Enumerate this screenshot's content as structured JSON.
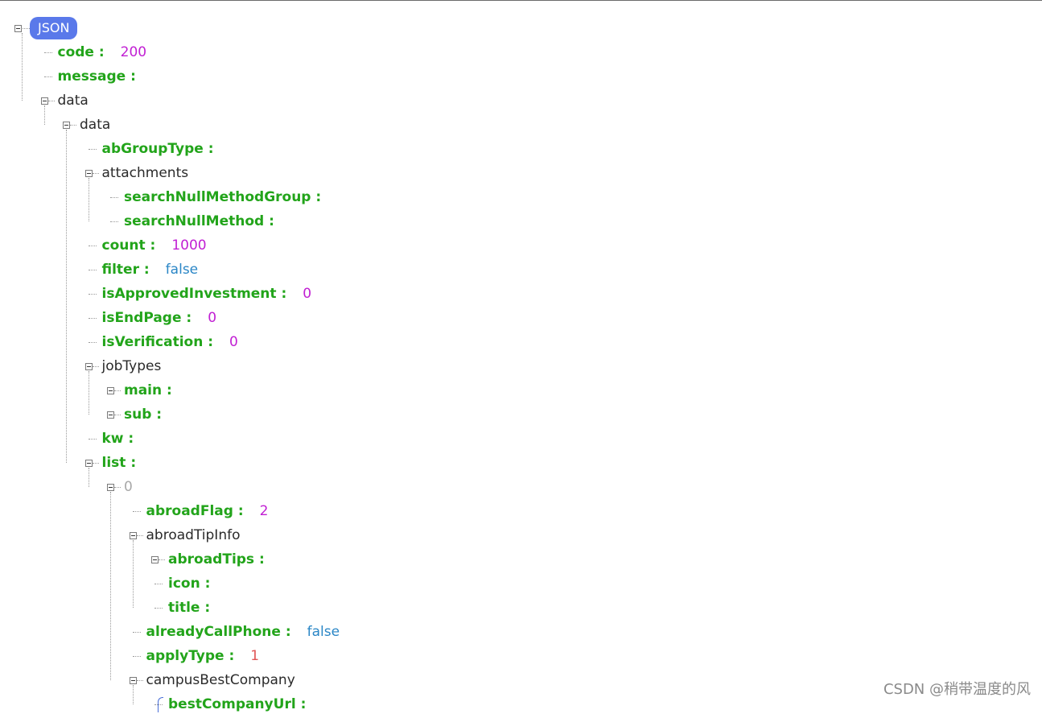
{
  "root_label": "JSON",
  "watermark": "CSDN @稍带温度的风",
  "colors": {
    "key": "#22a41a",
    "number": "#c11fd3",
    "boolean": "#2a86c6",
    "string_number": "#e05555",
    "index": "#a8a8a8",
    "root_badge": "#5a79ea"
  },
  "nodes": [
    {
      "depth": 1,
      "key": "code",
      "value": "200",
      "vtype": "num",
      "toggle": false
    },
    {
      "depth": 1,
      "key": "message",
      "value": "",
      "vtype": "",
      "toggle": false
    },
    {
      "depth": 1,
      "key": "data",
      "value": "",
      "vtype": "",
      "toggle": true,
      "plain": true
    },
    {
      "depth": 2,
      "key": "data",
      "value": "",
      "vtype": "",
      "toggle": true,
      "plain": true
    },
    {
      "depth": 3,
      "key": "abGroupType",
      "value": "",
      "vtype": "",
      "toggle": false
    },
    {
      "depth": 3,
      "key": "attachments",
      "value": "",
      "vtype": "",
      "toggle": true,
      "plain": true
    },
    {
      "depth": 4,
      "key": "searchNullMethodGroup",
      "value": "",
      "vtype": "",
      "toggle": false
    },
    {
      "depth": 4,
      "key": "searchNullMethod",
      "value": "",
      "vtype": "",
      "toggle": false
    },
    {
      "depth": 3,
      "key": "count",
      "value": "1000",
      "vtype": "num",
      "toggle": false
    },
    {
      "depth": 3,
      "key": "filter",
      "value": "false",
      "vtype": "bool",
      "toggle": false
    },
    {
      "depth": 3,
      "key": "isApprovedInvestment",
      "value": "0",
      "vtype": "num",
      "toggle": false
    },
    {
      "depth": 3,
      "key": "isEndPage",
      "value": "0",
      "vtype": "num",
      "toggle": false
    },
    {
      "depth": 3,
      "key": "isVerification",
      "value": "0",
      "vtype": "num",
      "toggle": false
    },
    {
      "depth": 3,
      "key": "jobTypes",
      "value": "",
      "vtype": "",
      "toggle": true,
      "plain": true
    },
    {
      "depth": 4,
      "key": "main",
      "value": "",
      "vtype": "",
      "toggle": true
    },
    {
      "depth": 4,
      "key": "sub",
      "value": "",
      "vtype": "",
      "toggle": true
    },
    {
      "depth": 3,
      "key": "kw",
      "value": "",
      "vtype": "",
      "toggle": false
    },
    {
      "depth": 3,
      "key": "list",
      "value": "",
      "vtype": "",
      "toggle": true
    },
    {
      "depth": 4,
      "key": "0",
      "value": "",
      "vtype": "",
      "toggle": true,
      "index": true
    },
    {
      "depth": 5,
      "key": "abroadFlag",
      "value": "2",
      "vtype": "num",
      "toggle": false
    },
    {
      "depth": 5,
      "key": "abroadTipInfo",
      "value": "",
      "vtype": "",
      "toggle": true,
      "plain": true
    },
    {
      "depth": 6,
      "key": "abroadTips",
      "value": "",
      "vtype": "",
      "toggle": true
    },
    {
      "depth": 6,
      "key": "icon",
      "value": "",
      "vtype": "",
      "toggle": false
    },
    {
      "depth": 6,
      "key": "title",
      "value": "",
      "vtype": "",
      "toggle": false
    },
    {
      "depth": 5,
      "key": "alreadyCallPhone",
      "value": "false",
      "vtype": "bool",
      "toggle": false
    },
    {
      "depth": 5,
      "key": "applyType",
      "value": "1",
      "vtype": "str",
      "toggle": false
    },
    {
      "depth": 5,
      "key": "campusBestCompany",
      "value": "",
      "vtype": "",
      "toggle": true,
      "plain": true
    },
    {
      "depth": 6,
      "key": "bestCompanyUrl",
      "value": "",
      "vtype": "",
      "toggle": false,
      "bracket": true
    }
  ]
}
